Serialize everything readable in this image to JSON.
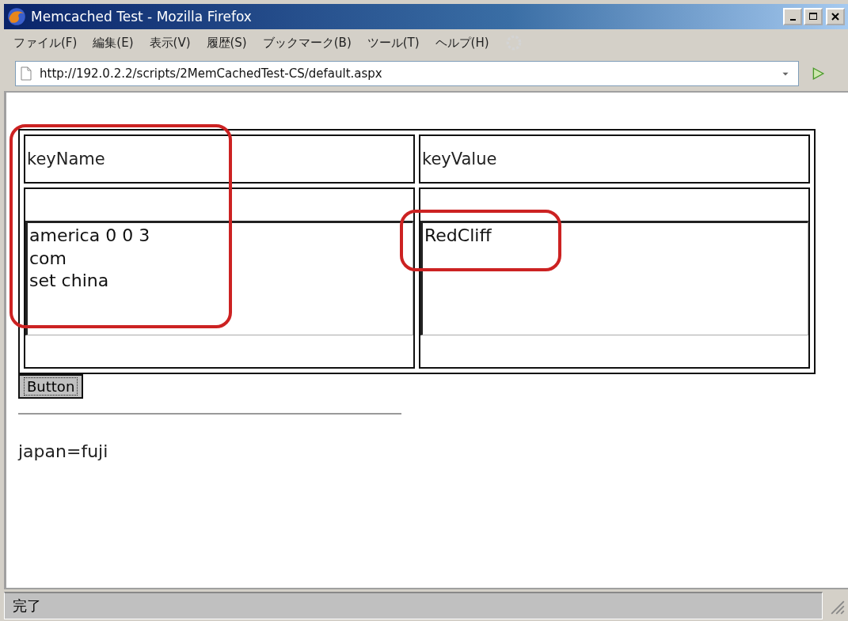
{
  "window": {
    "title": "Memcached Test - Mozilla Firefox"
  },
  "menu": [
    {
      "label": "ファイル(F)"
    },
    {
      "label": "編集(E)"
    },
    {
      "label": "表示(V)"
    },
    {
      "label": "履歴(S)"
    },
    {
      "label": "ブックマーク(B)"
    },
    {
      "label": "ツール(T)"
    },
    {
      "label": "ヘルプ(H)"
    }
  ],
  "address_bar": {
    "value": "http://192.0.2.2/scripts/2MemCachedTest-CS/default.aspx"
  },
  "table": {
    "columns": [
      {
        "label": "keyName"
      },
      {
        "label": "keyValue"
      }
    ],
    "fields": [
      {
        "value": "america 0 0 3\ncom\nset china",
        "highlighted": true
      },
      {
        "value": "RedCliff",
        "highlighted": true
      }
    ]
  },
  "button": {
    "label": "Button"
  },
  "result": "japan=fuji",
  "status_bar": {
    "text": "完了"
  }
}
